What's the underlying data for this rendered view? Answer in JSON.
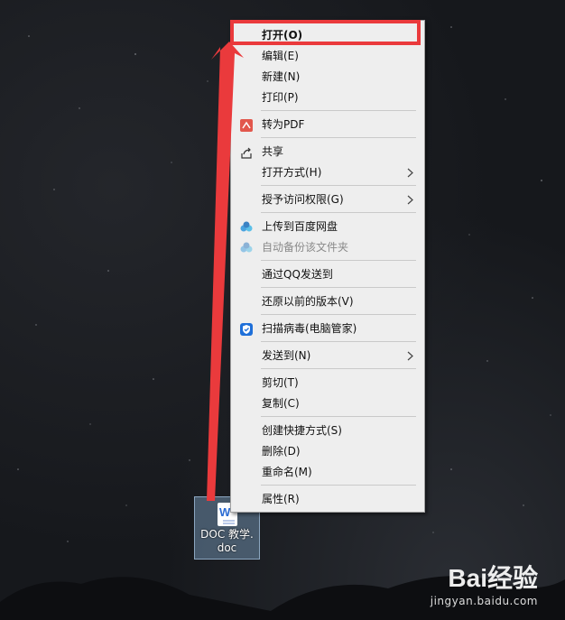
{
  "menu": {
    "items": [
      {
        "label": "打开(O)",
        "icon": "",
        "submenu": false,
        "bold": true
      },
      {
        "label": "编辑(E)",
        "icon": "",
        "submenu": false
      },
      {
        "label": "新建(N)",
        "icon": "",
        "submenu": false
      },
      {
        "label": "打印(P)",
        "icon": "",
        "submenu": false
      },
      {
        "label": "转为PDF",
        "icon": "pdf-convert-icon",
        "submenu": false
      },
      {
        "label": "共享",
        "icon": "share-icon",
        "submenu": false
      },
      {
        "label": "打开方式(H)",
        "icon": "",
        "submenu": true
      },
      {
        "label": "授予访问权限(G)",
        "icon": "",
        "submenu": true
      },
      {
        "label": "上传到百度网盘",
        "icon": "baidu-netdisk-icon",
        "submenu": false
      },
      {
        "label": "自动备份该文件夹",
        "icon": "baidu-netdisk-icon",
        "submenu": false,
        "disabled": true
      },
      {
        "label": "通过QQ发送到",
        "icon": "",
        "submenu": false
      },
      {
        "label": "还原以前的版本(V)",
        "icon": "",
        "submenu": false
      },
      {
        "label": "扫描病毒(电脑管家)",
        "icon": "tencent-pc-manager-shield-icon",
        "submenu": false
      },
      {
        "label": "发送到(N)",
        "icon": "",
        "submenu": true
      },
      {
        "label": "剪切(T)",
        "icon": "",
        "submenu": false
      },
      {
        "label": "复制(C)",
        "icon": "",
        "submenu": false
      },
      {
        "label": "创建快捷方式(S)",
        "icon": "",
        "submenu": false
      },
      {
        "label": "删除(D)",
        "icon": "",
        "submenu": false
      },
      {
        "label": "重命名(M)",
        "icon": "",
        "submenu": false
      },
      {
        "label": "属性(R)",
        "icon": "",
        "submenu": false
      }
    ]
  },
  "desktop_icon": {
    "label": "DOC 教学.\ndoc",
    "icon": "word-document-icon"
  },
  "annotation": {
    "highlight_color": "#ea3a3c"
  },
  "watermark": {
    "main": "Bai经验",
    "sub": "jingyan.baidu.com"
  }
}
